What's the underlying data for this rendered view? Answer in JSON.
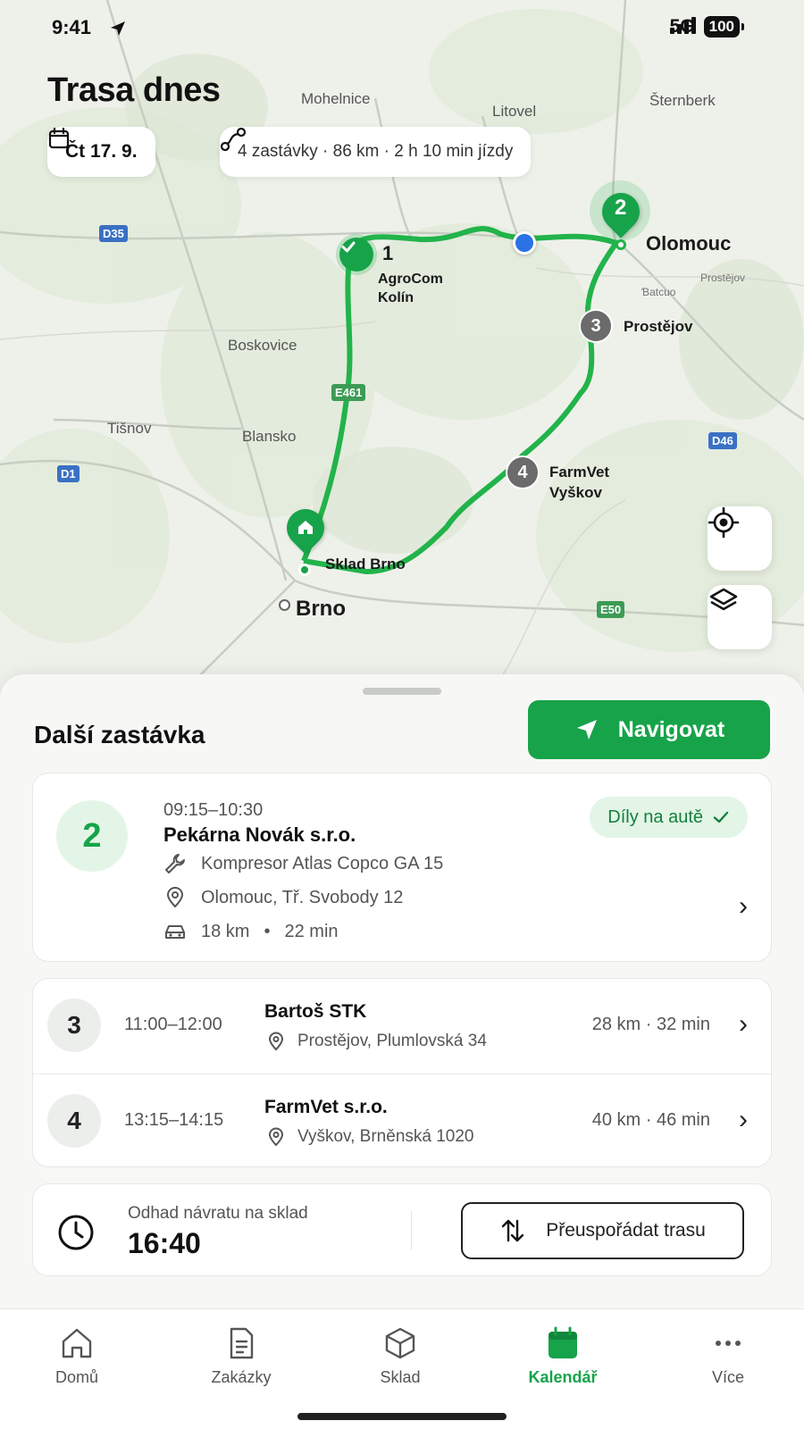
{
  "status_bar": {
    "time": "9:41",
    "network": "5G",
    "battery": "100"
  },
  "page_title": "Trasa dnes",
  "date_chip": {
    "label": "Čt 17. 9."
  },
  "summary_chip": {
    "label": "4 zastávky · 86 km · 2 h 10 min jízdy"
  },
  "map": {
    "towns": [
      "Mohelnice",
      "Litovel",
      "Šternberk",
      "Boskovice",
      "Tišnov",
      "Blansko",
      "Prostějov",
      "Ɓatcuo"
    ],
    "major_towns": [
      "Olomouc",
      "Brno"
    ],
    "road_shields": [
      "D35",
      "E461",
      "D46",
      "D1",
      "E50"
    ],
    "markers": {
      "stop1_num": "1",
      "stop1_name": "AgroCom\nKolín",
      "stop2_num": "2",
      "stop3_num": "3",
      "stop3_name": "Prostějov",
      "stop4_num": "4",
      "stop4_name": "FarmVet\nVyškov",
      "warehouse_name": "Sklad Brno"
    },
    "route_color": "#22b34b",
    "current_location_color": "#2b72e4"
  },
  "sheet": {
    "title": "Další zastávka",
    "navigate_label": "Navigovat",
    "next_stop": {
      "number": "2",
      "time": "09:15–10:30",
      "name": "Pekárna Novák s.r.o.",
      "equipment": "Kompresor Atlas Copco GA 15",
      "address": "Olomouc, Tř. Svobody 12",
      "distance": "18 km",
      "duration": "22 min",
      "badge": "Díly na autě"
    },
    "upcoming": [
      {
        "number": "3",
        "time": "11:00–12:00",
        "name": "Bartoš STK",
        "address": "Prostějov, Plumlovská 34",
        "distance": "28 km · 32 min"
      },
      {
        "number": "4",
        "time": "13:15–14:15",
        "name": "FarmVet s.r.o.",
        "address": "Vyškov, Brněnská 1020",
        "distance": "40 km · 46 min"
      }
    ],
    "eta": {
      "label": "Odhad návratu na sklad",
      "time": "16:40"
    },
    "reorder_label": "Přeuspořádat trasu"
  },
  "tabs": [
    {
      "label": "Domů",
      "icon": "home-icon",
      "active": false
    },
    {
      "label": "Zakázky",
      "icon": "document-icon",
      "active": false
    },
    {
      "label": "Sklad",
      "icon": "box-icon",
      "active": false
    },
    {
      "label": "Kalendář",
      "icon": "calendar-icon",
      "active": true
    },
    {
      "label": "Více",
      "icon": "more-icon",
      "active": false
    }
  ],
  "colors": {
    "accent": "#17a34a",
    "accent_light": "#e2f5e6"
  }
}
